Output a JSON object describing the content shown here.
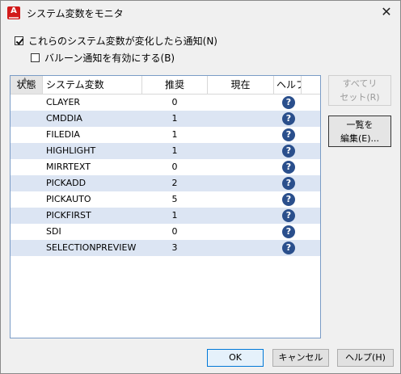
{
  "window": {
    "title": "システム変数をモニタ",
    "app_icon_letter": "A"
  },
  "options": {
    "notify_label": "これらのシステム変数が変化したら通知(N)",
    "notify_checked": true,
    "balloon_label": "バルーン通知を有効にする(B)",
    "balloon_checked": false
  },
  "table": {
    "columns": {
      "status": "状態",
      "sysvar": "システム変数",
      "recommended": "推奨",
      "current": "現在",
      "help": "ヘルプ"
    },
    "rows": [
      {
        "name": "CLAYER",
        "recommended": "0"
      },
      {
        "name": "CMDDIA",
        "recommended": "1"
      },
      {
        "name": "FILEDIA",
        "recommended": "1"
      },
      {
        "name": "HIGHLIGHT",
        "recommended": "1"
      },
      {
        "name": "MIRRTEXT",
        "recommended": "0"
      },
      {
        "name": "PICKADD",
        "recommended": "2"
      },
      {
        "name": "PICKAUTO",
        "recommended": "5"
      },
      {
        "name": "PICKFIRST",
        "recommended": "1"
      },
      {
        "name": "SDI",
        "recommended": "0"
      },
      {
        "name": "SELECTIONPREVIEW",
        "recommended": "3"
      }
    ],
    "help_glyph": "?"
  },
  "side_buttons": {
    "reset_line1": "すべてリ",
    "reset_line2": "セット(R)",
    "edit_line1": "一覧を",
    "edit_line2": "編集(E)..."
  },
  "footer": {
    "ok": "OK",
    "cancel": "キャンセル",
    "help": "ヘルプ(H)"
  },
  "colors": {
    "alt_row": "#dce5f3",
    "help_icon": "#2a4f8c",
    "app_icon": "#d21a1a"
  }
}
